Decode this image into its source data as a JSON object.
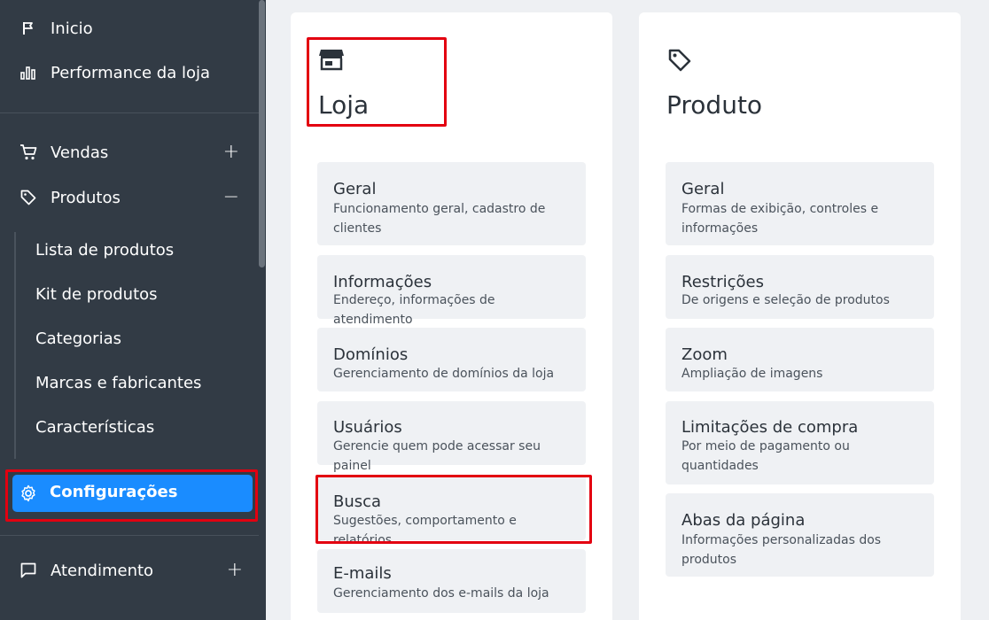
{
  "sidebar": {
    "top_items": [
      {
        "label": "Inicio",
        "icon": "flag-icon"
      },
      {
        "label": "Performance da loja",
        "icon": "bar-chart-icon"
      }
    ],
    "vendas": {
      "label": "Vendas",
      "icon": "cart-icon",
      "toggle": "+"
    },
    "produtos": {
      "label": "Produtos",
      "icon": "tag-icon",
      "toggle": "−",
      "children": [
        "Lista de produtos",
        "Kit de produtos",
        "Categorias",
        "Marcas e fabricantes",
        "Características"
      ]
    },
    "configuracoes": {
      "label": "Configurações",
      "icon": "gear-icon",
      "active": true
    },
    "atendimento": {
      "label": "Atendimento",
      "icon": "chat-icon",
      "toggle": "+"
    }
  },
  "loja": {
    "title": "Loja",
    "icon": "store-icon",
    "tiles": [
      {
        "title": "Geral",
        "desc": "Funcionamento geral, cadastro de clientes"
      },
      {
        "title": "Informações",
        "desc": "Endereço, informações de atendimento"
      },
      {
        "title": "Domínios",
        "desc": "Gerenciamento de domínios da loja"
      },
      {
        "title": "Usuários",
        "desc": "Gerencie quem pode acessar seu painel"
      },
      {
        "title": "Busca",
        "desc": "Sugestões, comportamento e relatórios"
      },
      {
        "title": "E-mails",
        "desc": "Gerenciamento dos e-mails da loja"
      }
    ]
  },
  "produto": {
    "title": "Produto",
    "icon": "price-tag-icon",
    "tiles": [
      {
        "title": "Geral",
        "desc": "Formas de exibição, controles e informações"
      },
      {
        "title": "Restrições",
        "desc": "De origens e seleção de produtos"
      },
      {
        "title": "Zoom",
        "desc": "Ampliação de imagens"
      },
      {
        "title": "Limitações de compra",
        "desc": "Por meio de pagamento ou quantidades"
      },
      {
        "title": "Abas da página",
        "desc": "Informações personalizadas dos produtos"
      }
    ]
  },
  "colors": {
    "sidebar_bg": "#323b45",
    "active_blue": "#1a8cff",
    "highlight_red": "#e30010",
    "tile_bg": "#eff1f4"
  }
}
